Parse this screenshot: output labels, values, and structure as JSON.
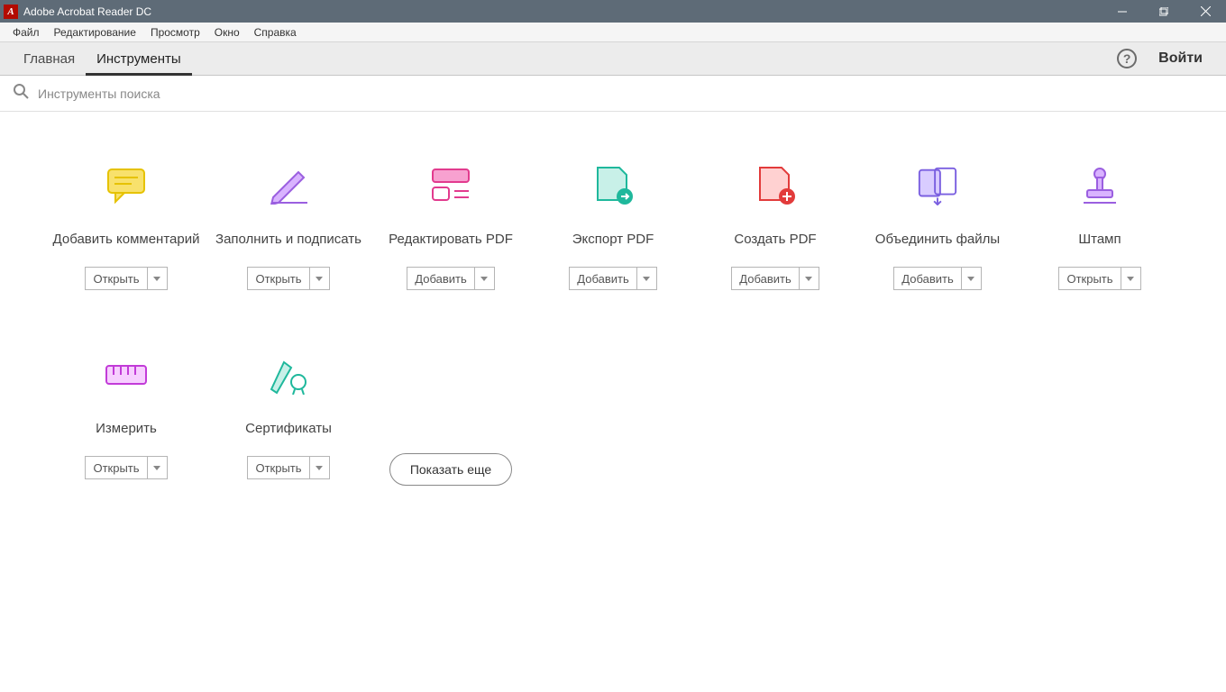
{
  "titlebar": {
    "title": "Adobe Acrobat Reader DC"
  },
  "menubar": {
    "items": [
      "Файл",
      "Редактирование",
      "Просмотр",
      "Окно",
      "Справка"
    ]
  },
  "tabbar": {
    "tabs": [
      {
        "label": "Главная",
        "active": false
      },
      {
        "label": "Инструменты",
        "active": true
      }
    ],
    "signin": "Войти"
  },
  "search": {
    "placeholder": "Инструменты поиска"
  },
  "tools": [
    {
      "id": "comment",
      "label": "Добавить комментарий",
      "action": "Открыть",
      "icon": "comment"
    },
    {
      "id": "fillsign",
      "label": "Заполнить и подписать",
      "action": "Открыть",
      "icon": "pen"
    },
    {
      "id": "editpdf",
      "label": "Редактировать PDF",
      "action": "Добавить",
      "icon": "edit"
    },
    {
      "id": "exportpdf",
      "label": "Экспорт PDF",
      "action": "Добавить",
      "icon": "export"
    },
    {
      "id": "createpdf",
      "label": "Создать PDF",
      "action": "Добавить",
      "icon": "create"
    },
    {
      "id": "combine",
      "label": "Объединить файлы",
      "action": "Добавить",
      "icon": "combine"
    },
    {
      "id": "stamp",
      "label": "Штамп",
      "action": "Открыть",
      "icon": "stamp"
    },
    {
      "id": "measure",
      "label": "Измерить",
      "action": "Открыть",
      "icon": "ruler"
    },
    {
      "id": "cert",
      "label": "Сертификаты",
      "action": "Открыть",
      "icon": "cert"
    }
  ],
  "show_more": "Показать еще"
}
